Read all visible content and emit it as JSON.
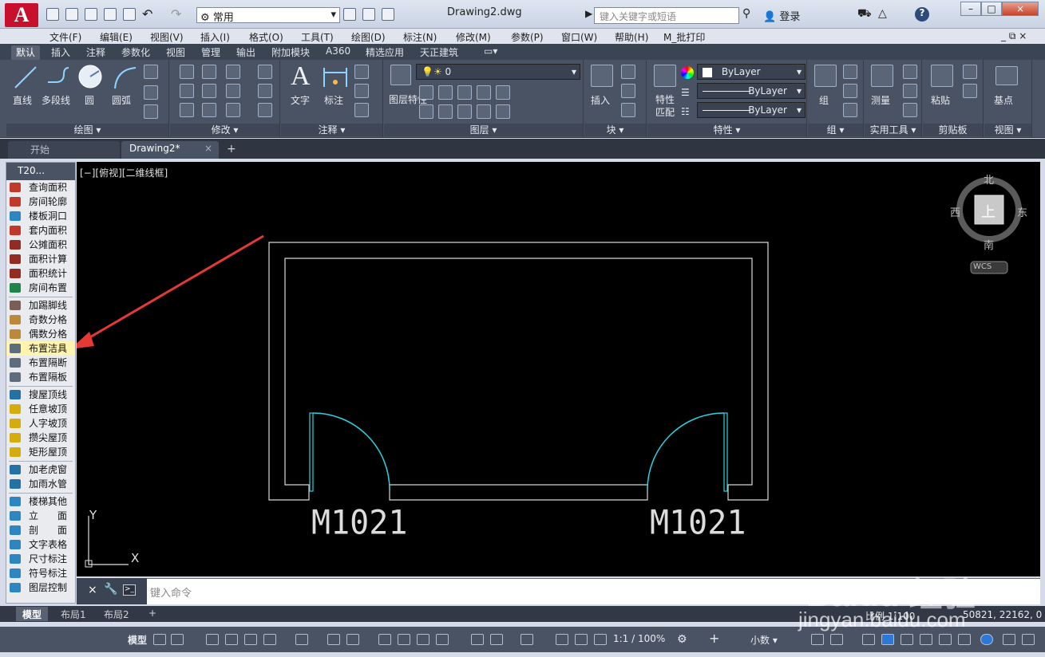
{
  "app": {
    "logo": "A",
    "title": "Drawing2.dwg",
    "workspace": "常用",
    "search_placeholder": "键入关键字或短语",
    "login": "登录",
    "help": "?"
  },
  "window": {
    "minimize": "–",
    "maximize": "□",
    "close": "×"
  },
  "menu": [
    "文件(F)",
    "编辑(E)",
    "视图(V)",
    "插入(I)",
    "格式(O)",
    "工具(T)",
    "绘图(D)",
    "标注(N)",
    "修改(M)",
    "参数(P)",
    "窗口(W)",
    "帮助(H)",
    "M_批打印"
  ],
  "ribbon_tabs": [
    "默认",
    "插入",
    "注释",
    "参数化",
    "视图",
    "管理",
    "输出",
    "附加模块",
    "A360",
    "精选应用",
    "天正建筑"
  ],
  "ribbon": {
    "draw": {
      "title": "绘图",
      "tools": [
        "直线",
        "多段线",
        "圆",
        "圆弧"
      ]
    },
    "modify": {
      "title": "修改"
    },
    "annotation": {
      "title": "注释",
      "tools": [
        "文字",
        "标注"
      ]
    },
    "layers": {
      "title": "图层",
      "tool": "图层特性",
      "current_layer": "0"
    },
    "block": {
      "title": "块",
      "tool": "插入"
    },
    "properties": {
      "title": "特性",
      "tool": "特性匹配",
      "color": "ByLayer",
      "linetype": "ByLayer",
      "lineweight": "ByLayer"
    },
    "groups": {
      "title": "组",
      "tool": "组"
    },
    "utilities": {
      "title": "实用工具",
      "tool": "测量"
    },
    "clipboard": {
      "title": "剪贴板",
      "tool": "粘贴"
    },
    "view": {
      "title": "视图",
      "tool": "基点"
    }
  },
  "doc_tabs": [
    "开始",
    "Drawing2*"
  ],
  "palette": {
    "title": "T20...",
    "items": [
      {
        "label": "查询面积",
        "color": "#c0392b"
      },
      {
        "label": "房间轮廓",
        "color": "#c0392b"
      },
      {
        "label": "楼板洞口",
        "color": "#2e86c1"
      },
      {
        "label": "套内面积",
        "color": "#c0392b"
      },
      {
        "label": "公摊面积",
        "color": "#922b21"
      },
      {
        "label": "面积计算",
        "color": "#922b21"
      },
      {
        "label": "面积统计",
        "color": "#922b21"
      },
      {
        "label": "房间布置",
        "color": "#1e8449"
      },
      {
        "label": "加踢脚线",
        "color": "#7b5e57"
      },
      {
        "label": "奇数分格",
        "color": "#ba8a3a"
      },
      {
        "label": "偶数分格",
        "color": "#ba8a3a"
      },
      {
        "label": "布置洁具",
        "color": "#5d6d7e"
      },
      {
        "label": "布置隔断",
        "color": "#5d6d7e"
      },
      {
        "label": "布置隔板",
        "color": "#5d6d7e"
      },
      {
        "label": "搜屋顶线",
        "color": "#2471a3"
      },
      {
        "label": "任意坡顶",
        "color": "#d4ac0d"
      },
      {
        "label": "人字坡顶",
        "color": "#d4ac0d"
      },
      {
        "label": "攒尖屋顶",
        "color": "#d4ac0d"
      },
      {
        "label": "矩形屋顶",
        "color": "#d4ac0d"
      },
      {
        "label": "加老虎窗",
        "color": "#2471a3"
      },
      {
        "label": "加雨水管",
        "color": "#2471a3"
      },
      {
        "label": "楼梯其他",
        "color": "#2e86c1"
      },
      {
        "label": "立　　面",
        "color": "#2e86c1"
      },
      {
        "label": "剖　　面",
        "color": "#2e86c1"
      },
      {
        "label": "文字表格",
        "color": "#2e86c1"
      },
      {
        "label": "尺寸标注",
        "color": "#2e86c1"
      },
      {
        "label": "符号标注",
        "color": "#2e86c1"
      },
      {
        "label": "图层控制",
        "color": "#2e86c1"
      }
    ],
    "highlighted": "布置洁具"
  },
  "viewport": {
    "label": "[−][俯视][二维线框]",
    "door_labels": [
      "M1021",
      "M1021"
    ],
    "ucs_x": "X",
    "ucs_y": "Y"
  },
  "viewcube": {
    "north": "北",
    "south": "南",
    "east": "东",
    "west": "西",
    "face": "上",
    "ucs": "WCS"
  },
  "command": {
    "placeholder": "键入命令"
  },
  "layout_tabs": [
    "模型",
    "布局1",
    "布局2"
  ],
  "status": {
    "model": "模型",
    "scale_label": "1:1 / 100%",
    "units": "小数",
    "drawing_scale": "比例 1:100",
    "coords": "50821, 22162, 0"
  },
  "watermark": {
    "brand": "Baidu 经验",
    "url": "jingyan.baidu.com"
  }
}
